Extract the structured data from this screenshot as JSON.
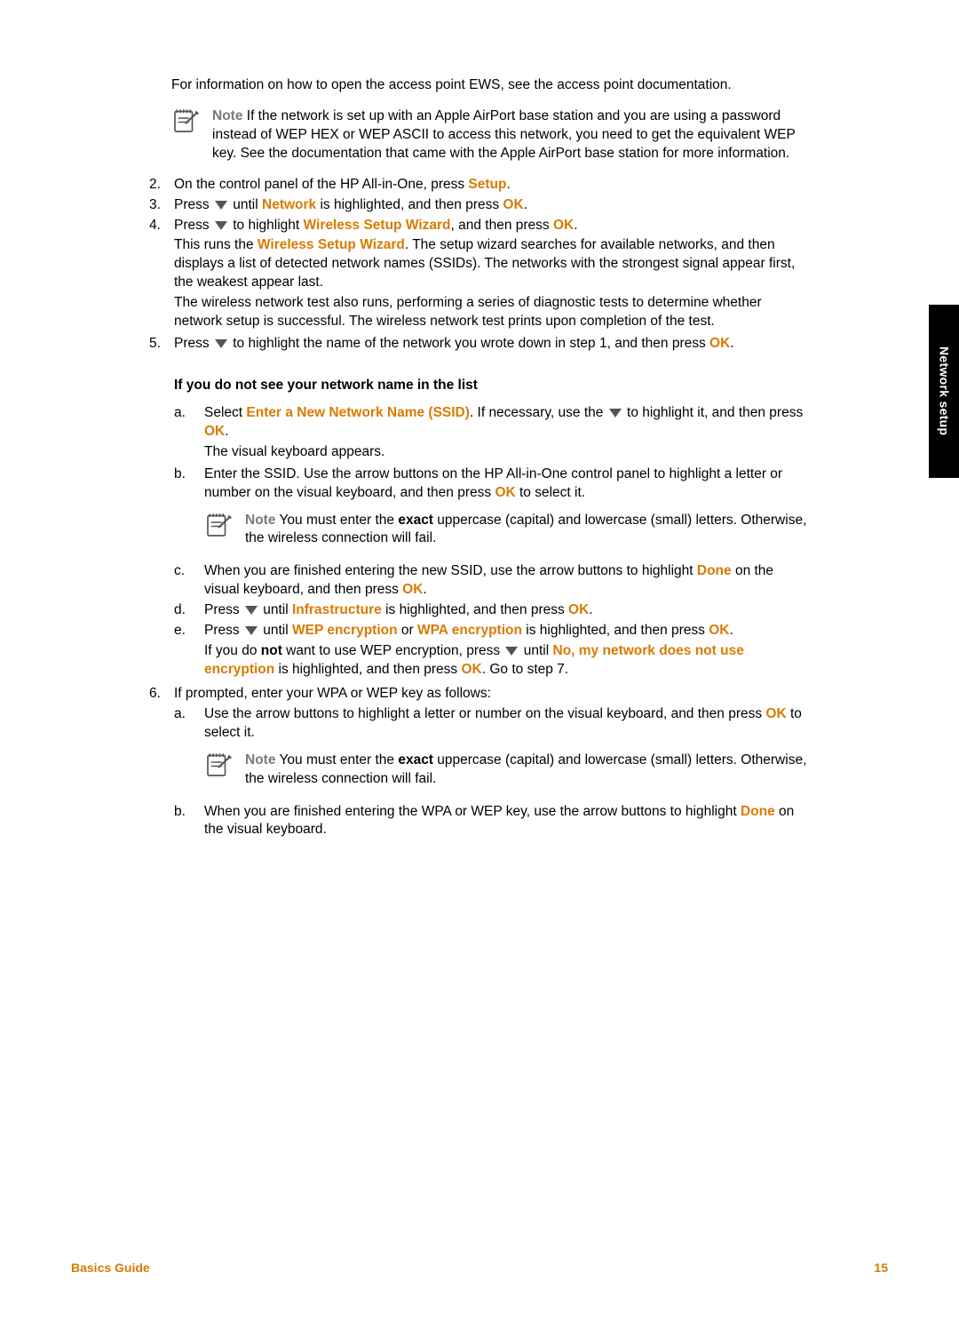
{
  "sideTab": "Network setup",
  "footer": {
    "left": "Basics Guide",
    "right": "15"
  },
  "intro": "For information on how to open the access point EWS, see the access point documentation.",
  "note1": {
    "label": "Note",
    "text": " If the network is set up with an Apple AirPort base station and you are using a password instead of WEP HEX or WEP ASCII to access this network, you need to get the equivalent WEP key. See the documentation that came with the Apple AirPort base station for more information."
  },
  "step2": {
    "num": "2.",
    "a": "On the control panel of the HP All-in-One, press ",
    "setup": "Setup",
    "b": "."
  },
  "step3": {
    "num": "3.",
    "a": "Press ",
    "b": " until ",
    "network": "Network",
    "c": " is highlighted, and then press ",
    "ok": "OK",
    "d": "."
  },
  "step4": {
    "num": "4.",
    "l1a": "Press ",
    "l1b": " to highlight ",
    "wsw": "Wireless Setup Wizard",
    "l1c": ", and then press ",
    "ok": "OK",
    "l1d": ".",
    "l2a": "This runs the ",
    "l2b": ". The setup wizard searches for available networks, and then displays a list of detected network names (SSIDs). The networks with the strongest signal appear first, the weakest appear last.",
    "l3": "The wireless network test also runs, performing a series of diagnostic tests to determine whether network setup is successful. The wireless network test prints upon completion of the test."
  },
  "step5": {
    "num": "5.",
    "a": "Press ",
    "b": " to highlight the name of the network you wrote down in step 1, and then press ",
    "ok": "OK",
    "c": "."
  },
  "subTitle": "If you do not see your network name in the list",
  "sa": {
    "num": "a.",
    "l1a": "Select ",
    "enter": "Enter a New Network Name (SSID)",
    "l1b": ". If necessary, use the ",
    "l1c": " to highlight it, and then press ",
    "ok": "OK",
    "l1d": ".",
    "l2": "The visual keyboard appears."
  },
  "sb": {
    "num": "b.",
    "a": "Enter the SSID. Use the arrow buttons on the HP All-in-One control panel to highlight a letter or number on the visual keyboard, and then press ",
    "ok": "OK",
    "b": " to select it."
  },
  "note2": {
    "label": "Note",
    "a": " You must enter the ",
    "exact": "exact",
    "b": " uppercase (capital) and lowercase (small) letters. Otherwise, the wireless connection will fail."
  },
  "sc": {
    "num": "c.",
    "a": "When you are finished entering the new SSID, use the arrow buttons to highlight ",
    "done": "Done",
    "b": " on the visual keyboard, and then press ",
    "ok": "OK",
    "c": "."
  },
  "sd": {
    "num": "d.",
    "a": "Press ",
    "b": " until ",
    "infra": "Infrastructure",
    "c": " is highlighted, and then press ",
    "ok": "OK",
    "d": "."
  },
  "se": {
    "num": "e.",
    "l1a": "Press ",
    "l1b": " until ",
    "wep": "WEP encryption",
    "or": " or ",
    "wpa": "WPA encryption",
    "l1c": " is highlighted, and then press ",
    "ok": "OK",
    "l1d": ".",
    "l2a": "If you do ",
    "not": "not",
    "l2b": " want to use WEP encryption, press ",
    "l2c": " until ",
    "noenc": "No, my network does not use encryption",
    "l2d": " is highlighted, and then press ",
    "l2e": ". Go to step 7."
  },
  "step6": {
    "num": "6.",
    "intro": "If prompted, enter your WPA or WEP key as follows:"
  },
  "s6a": {
    "num": "a.",
    "a": "Use the arrow buttons to highlight a letter or number on the visual keyboard, and then press ",
    "ok": "OK",
    "b": " to select it."
  },
  "s6b": {
    "num": "b.",
    "a": "When you are finished entering the WPA or WEP key, use the arrow buttons to highlight ",
    "done": "Done",
    "b": " on the visual keyboard."
  }
}
